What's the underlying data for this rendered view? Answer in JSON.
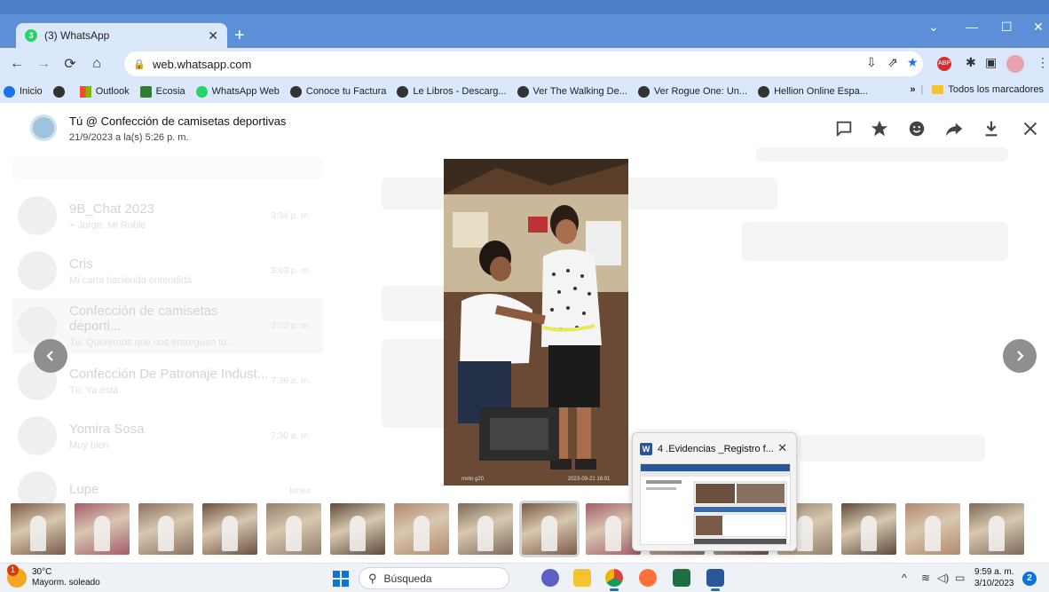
{
  "browser": {
    "tab_title": "(3) WhatsApp",
    "tab_badge": "3",
    "url": "web.whatsapp.com",
    "bookmarks": [
      {
        "label": "Inicio",
        "color": "#1a73e8"
      },
      {
        "label": "",
        "color": "#333333"
      },
      {
        "label": "Outlook",
        "color": "#f25022"
      },
      {
        "label": "Ecosia",
        "color": "#2e7d32"
      },
      {
        "label": "WhatsApp Web",
        "color": "#25d366"
      },
      {
        "label": "Conoce tu Factura",
        "color": "#333333"
      },
      {
        "label": "Le Libros - Descarg...",
        "color": "#333333"
      },
      {
        "label": "Ver The Walking De...",
        "color": "#333333"
      },
      {
        "label": "Ver Rogue One: Un...",
        "color": "#333333"
      },
      {
        "label": "Hellion Online Espa...",
        "color": "#333333"
      }
    ],
    "bookmarks_overflow": "»",
    "all_bookmarks": "Todos los marcadores"
  },
  "viewer": {
    "sender": "Tú @ Confección de camisetas deportivas",
    "timestamp": "21/9/2023 a la(s) 5:26 p. m.",
    "thumb_count": 16,
    "selected_thumb": 8
  },
  "background_chats": [
    {
      "name": "9B_Chat 2023",
      "sub": "+ Jorge: Mi Roble",
      "time": "3:34 p. m."
    },
    {
      "name": "Cris",
      "sub": "Mi carta hacienda entendida",
      "time": "3:03 p. m."
    },
    {
      "name": "Confección de camisetas deporti...",
      "sub": "Tú: Queremos que nos entreguen tu ...",
      "time": "3:02 p. m."
    },
    {
      "name": "Confección De Patronaje Indust...",
      "sub": "Tú: Ya está",
      "time": "7:36 a. m."
    },
    {
      "name": "Yomira Sosa",
      "sub": "Muy bien",
      "time": "7:30 a. m."
    },
    {
      "name": "Lupe",
      "sub": "",
      "time": "lunes"
    }
  ],
  "preview": {
    "title": "4 .Evidencias _Registro f...",
    "icon": "W"
  },
  "taskbar": {
    "temperature": "30°C",
    "weather": "Mayorm. soleado",
    "weather_badge": "1",
    "search_placeholder": "Búsqueda",
    "time": "9:59 a. m.",
    "date": "3/10/2023",
    "notifications": "2"
  }
}
